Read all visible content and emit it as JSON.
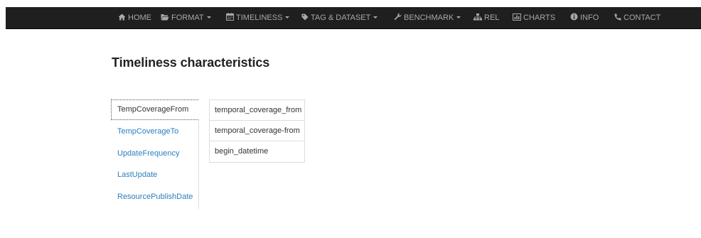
{
  "navbar": {
    "items": [
      {
        "label": "HOME",
        "icon": "home-icon",
        "dropdown": false
      },
      {
        "label": "FORMAT",
        "icon": "folder-icon",
        "dropdown": true
      },
      {
        "label": "TIMELINESS",
        "icon": "calendar-icon",
        "dropdown": true
      },
      {
        "label": "TAG & DATASET",
        "icon": "tag-icon",
        "dropdown": true
      },
      {
        "label": "BENCHMARK",
        "icon": "wrench-icon",
        "dropdown": true
      },
      {
        "label": "REL",
        "icon": "sitemap-icon",
        "dropdown": false
      },
      {
        "label": "CHARTS",
        "icon": "bar-chart-icon",
        "dropdown": false
      },
      {
        "label": "INFO",
        "icon": "info-icon",
        "dropdown": false
      },
      {
        "label": "CONTACT",
        "icon": "phone-icon",
        "dropdown": false
      }
    ]
  },
  "page": {
    "title": "Timeliness characteristics"
  },
  "side_nav": {
    "items": [
      {
        "label": "TempCoverageFrom",
        "active": true
      },
      {
        "label": "TempCoverageTo",
        "active": false
      },
      {
        "label": "UpdateFrequency",
        "active": false
      },
      {
        "label": "LastUpdate",
        "active": false
      },
      {
        "label": "ResourcePublishDate",
        "active": false
      }
    ]
  },
  "values": {
    "rows": [
      "temporal_coverage_from",
      "temporal_coverage-from",
      "begin_datetime"
    ]
  },
  "colors": {
    "navbar_bg": "#1f1f1f",
    "nav_text": "#a8a8a8",
    "link": "#2a7fc0",
    "border": "#dddddd"
  }
}
